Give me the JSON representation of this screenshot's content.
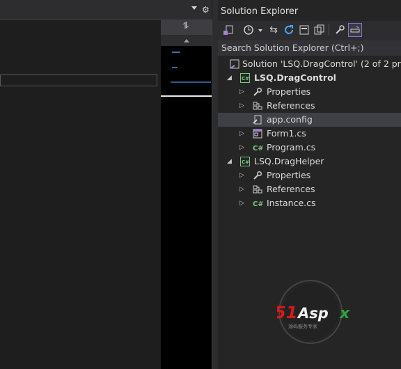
{
  "explorer": {
    "title": "Solution Explorer",
    "search_placeholder": "Search Solution Explorer (Ctrl+;)",
    "toolbar": [
      {
        "name": "home-icon",
        "glyph": "⌂"
      },
      {
        "name": "history-icon",
        "glyph": "◷"
      },
      {
        "name": "sync-icon",
        "glyph": "⇆"
      },
      {
        "name": "refresh-icon",
        "glyph": "↻"
      },
      {
        "name": "collapse-icon",
        "glyph": "▣"
      },
      {
        "name": "copy-icon",
        "glyph": "❐"
      },
      {
        "name": "properties-icon",
        "glyph": "🔧"
      },
      {
        "name": "preview-icon",
        "glyph": "▭"
      }
    ],
    "tree": [
      {
        "label": "Solution 'LSQ.DragControl' (2 of 2 projects)",
        "icon": "solution-icon",
        "depth": 0,
        "arrow": ""
      },
      {
        "label": "LSQ.DragControl",
        "icon": "csproj-icon",
        "depth": 1,
        "arrow": "expanded",
        "bold": true
      },
      {
        "label": "Properties",
        "icon": "wrench-icon",
        "depth": 2,
        "arrow": "collapsed"
      },
      {
        "label": "References",
        "icon": "references-icon",
        "depth": 2,
        "arrow": "collapsed"
      },
      {
        "label": "app.config",
        "icon": "config-icon",
        "depth": 2,
        "arrow": "",
        "selected": true
      },
      {
        "label": "Form1.cs",
        "icon": "form-icon",
        "depth": 2,
        "arrow": "collapsed"
      },
      {
        "label": "Program.cs",
        "icon": "csharp-icon",
        "depth": 2,
        "arrow": "collapsed"
      },
      {
        "label": "LSQ.DragHelper",
        "icon": "csproj-icon",
        "depth": 1,
        "arrow": "expanded"
      },
      {
        "label": "Properties",
        "icon": "wrench-icon",
        "depth": 2,
        "arrow": "collapsed"
      },
      {
        "label": "References",
        "icon": "references-icon",
        "depth": 2,
        "arrow": "collapsed"
      },
      {
        "label": "Instance.cs",
        "icon": "csharp-icon",
        "depth": 2,
        "arrow": "collapsed"
      }
    ]
  },
  "watermark": {
    "brand": "51Aspx",
    "tagline": "源码服务专家"
  },
  "colors": {
    "accent": "#7ec57e",
    "selection": "#3f3f46",
    "brand_red": "#d7191a",
    "brand_green": "#2fa043"
  }
}
